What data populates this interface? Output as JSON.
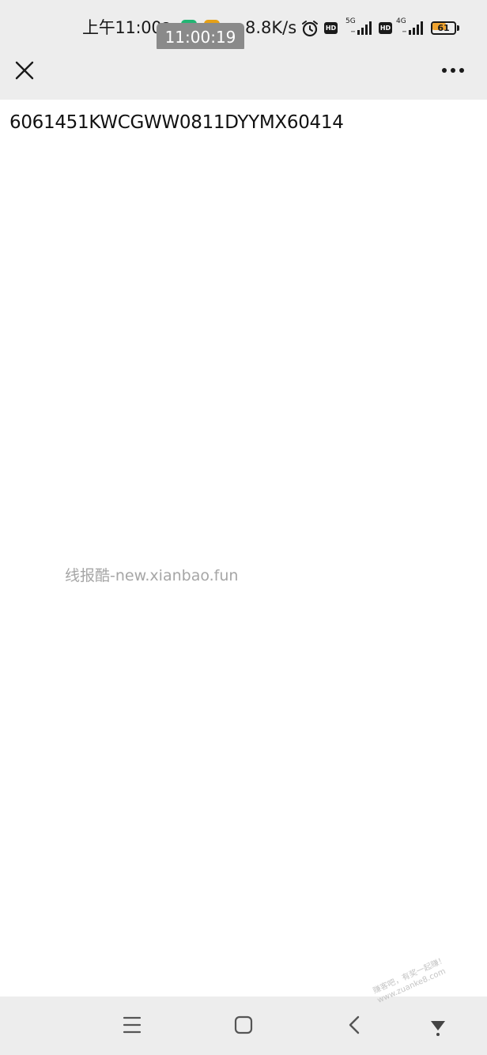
{
  "status_bar": {
    "time": "上午11:00",
    "network_speed": "8.8K/s",
    "network_type_1": "5G",
    "network_type_2": "4G",
    "hd_label": "HD",
    "battery_level": "61",
    "icons": [
      "notification-dot-icon",
      "green-app-icon",
      "orange-app-icon",
      "alarm-icon",
      "hd-icon",
      "signal-icon",
      "battery-icon"
    ]
  },
  "overlay": {
    "time_badge": "11:00:19"
  },
  "title_bar": {
    "icons": [
      "close-icon",
      "more-icon"
    ]
  },
  "content": {
    "code_text": "6061451KWCGWW0811DYYMX60414",
    "watermark": "线报酷-new.xianbao.fun"
  },
  "nav_bar": {
    "icons": [
      "menu-icon",
      "home-icon",
      "back-icon",
      "down-icon"
    ]
  },
  "corner_watermark": {
    "line1": "赚客吧，有奖一起赚！",
    "line2": "www.zuanke8.com"
  },
  "colors": {
    "bar_background": "#ededed",
    "content_background": "#ffffff",
    "battery_fill": "#f0a430",
    "green_app": "#22b573",
    "orange_app": "#e6a117"
  }
}
